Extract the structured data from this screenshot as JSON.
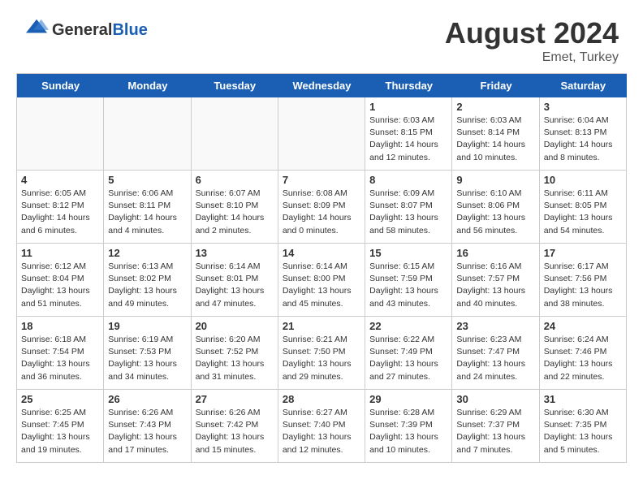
{
  "header": {
    "logo_general": "General",
    "logo_blue": "Blue",
    "month_year": "August 2024",
    "location": "Emet, Turkey"
  },
  "day_headers": [
    "Sunday",
    "Monday",
    "Tuesday",
    "Wednesday",
    "Thursday",
    "Friday",
    "Saturday"
  ],
  "weeks": [
    [
      {
        "day": "",
        "info": "",
        "empty": true
      },
      {
        "day": "",
        "info": "",
        "empty": true
      },
      {
        "day": "",
        "info": "",
        "empty": true
      },
      {
        "day": "",
        "info": "",
        "empty": true
      },
      {
        "day": "1",
        "info": "Sunrise: 6:03 AM\nSunset: 8:15 PM\nDaylight: 14 hours\nand 12 minutes.",
        "empty": false
      },
      {
        "day": "2",
        "info": "Sunrise: 6:03 AM\nSunset: 8:14 PM\nDaylight: 14 hours\nand 10 minutes.",
        "empty": false
      },
      {
        "day": "3",
        "info": "Sunrise: 6:04 AM\nSunset: 8:13 PM\nDaylight: 14 hours\nand 8 minutes.",
        "empty": false
      }
    ],
    [
      {
        "day": "4",
        "info": "Sunrise: 6:05 AM\nSunset: 8:12 PM\nDaylight: 14 hours\nand 6 minutes.",
        "empty": false
      },
      {
        "day": "5",
        "info": "Sunrise: 6:06 AM\nSunset: 8:11 PM\nDaylight: 14 hours\nand 4 minutes.",
        "empty": false
      },
      {
        "day": "6",
        "info": "Sunrise: 6:07 AM\nSunset: 8:10 PM\nDaylight: 14 hours\nand 2 minutes.",
        "empty": false
      },
      {
        "day": "7",
        "info": "Sunrise: 6:08 AM\nSunset: 8:09 PM\nDaylight: 14 hours\nand 0 minutes.",
        "empty": false
      },
      {
        "day": "8",
        "info": "Sunrise: 6:09 AM\nSunset: 8:07 PM\nDaylight: 13 hours\nand 58 minutes.",
        "empty": false
      },
      {
        "day": "9",
        "info": "Sunrise: 6:10 AM\nSunset: 8:06 PM\nDaylight: 13 hours\nand 56 minutes.",
        "empty": false
      },
      {
        "day": "10",
        "info": "Sunrise: 6:11 AM\nSunset: 8:05 PM\nDaylight: 13 hours\nand 54 minutes.",
        "empty": false
      }
    ],
    [
      {
        "day": "11",
        "info": "Sunrise: 6:12 AM\nSunset: 8:04 PM\nDaylight: 13 hours\nand 51 minutes.",
        "empty": false
      },
      {
        "day": "12",
        "info": "Sunrise: 6:13 AM\nSunset: 8:02 PM\nDaylight: 13 hours\nand 49 minutes.",
        "empty": false
      },
      {
        "day": "13",
        "info": "Sunrise: 6:14 AM\nSunset: 8:01 PM\nDaylight: 13 hours\nand 47 minutes.",
        "empty": false
      },
      {
        "day": "14",
        "info": "Sunrise: 6:14 AM\nSunset: 8:00 PM\nDaylight: 13 hours\nand 45 minutes.",
        "empty": false
      },
      {
        "day": "15",
        "info": "Sunrise: 6:15 AM\nSunset: 7:59 PM\nDaylight: 13 hours\nand 43 minutes.",
        "empty": false
      },
      {
        "day": "16",
        "info": "Sunrise: 6:16 AM\nSunset: 7:57 PM\nDaylight: 13 hours\nand 40 minutes.",
        "empty": false
      },
      {
        "day": "17",
        "info": "Sunrise: 6:17 AM\nSunset: 7:56 PM\nDaylight: 13 hours\nand 38 minutes.",
        "empty": false
      }
    ],
    [
      {
        "day": "18",
        "info": "Sunrise: 6:18 AM\nSunset: 7:54 PM\nDaylight: 13 hours\nand 36 minutes.",
        "empty": false
      },
      {
        "day": "19",
        "info": "Sunrise: 6:19 AM\nSunset: 7:53 PM\nDaylight: 13 hours\nand 34 minutes.",
        "empty": false
      },
      {
        "day": "20",
        "info": "Sunrise: 6:20 AM\nSunset: 7:52 PM\nDaylight: 13 hours\nand 31 minutes.",
        "empty": false
      },
      {
        "day": "21",
        "info": "Sunrise: 6:21 AM\nSunset: 7:50 PM\nDaylight: 13 hours\nand 29 minutes.",
        "empty": false
      },
      {
        "day": "22",
        "info": "Sunrise: 6:22 AM\nSunset: 7:49 PM\nDaylight: 13 hours\nand 27 minutes.",
        "empty": false
      },
      {
        "day": "23",
        "info": "Sunrise: 6:23 AM\nSunset: 7:47 PM\nDaylight: 13 hours\nand 24 minutes.",
        "empty": false
      },
      {
        "day": "24",
        "info": "Sunrise: 6:24 AM\nSunset: 7:46 PM\nDaylight: 13 hours\nand 22 minutes.",
        "empty": false
      }
    ],
    [
      {
        "day": "25",
        "info": "Sunrise: 6:25 AM\nSunset: 7:45 PM\nDaylight: 13 hours\nand 19 minutes.",
        "empty": false
      },
      {
        "day": "26",
        "info": "Sunrise: 6:26 AM\nSunset: 7:43 PM\nDaylight: 13 hours\nand 17 minutes.",
        "empty": false
      },
      {
        "day": "27",
        "info": "Sunrise: 6:26 AM\nSunset: 7:42 PM\nDaylight: 13 hours\nand 15 minutes.",
        "empty": false
      },
      {
        "day": "28",
        "info": "Sunrise: 6:27 AM\nSunset: 7:40 PM\nDaylight: 13 hours\nand 12 minutes.",
        "empty": false
      },
      {
        "day": "29",
        "info": "Sunrise: 6:28 AM\nSunset: 7:39 PM\nDaylight: 13 hours\nand 10 minutes.",
        "empty": false
      },
      {
        "day": "30",
        "info": "Sunrise: 6:29 AM\nSunset: 7:37 PM\nDaylight: 13 hours\nand 7 minutes.",
        "empty": false
      },
      {
        "day": "31",
        "info": "Sunrise: 6:30 AM\nSunset: 7:35 PM\nDaylight: 13 hours\nand 5 minutes.",
        "empty": false
      }
    ]
  ]
}
